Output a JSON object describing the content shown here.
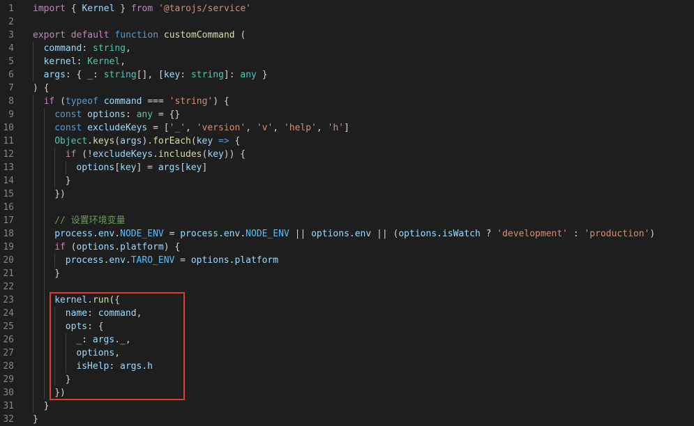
{
  "editor": {
    "highlight_color": "#e53935",
    "lines": [
      {
        "n": "1",
        "indent": 0,
        "tokens": [
          [
            "import",
            "ctl"
          ],
          [
            " { ",
            "punc"
          ],
          [
            "Kernel",
            "var"
          ],
          [
            " } ",
            "punc"
          ],
          [
            "from",
            "ctl"
          ],
          [
            " ",
            "punc"
          ],
          [
            "'@tarojs/service'",
            "str"
          ]
        ]
      },
      {
        "n": "2",
        "indent": 0,
        "tokens": []
      },
      {
        "n": "3",
        "indent": 0,
        "tokens": [
          [
            "export",
            "ctl"
          ],
          [
            " ",
            "punc"
          ],
          [
            "default",
            "ctl"
          ],
          [
            " ",
            "punc"
          ],
          [
            "function",
            "kw"
          ],
          [
            " ",
            "punc"
          ],
          [
            "customCommand",
            "fn"
          ],
          [
            " (",
            "punc"
          ]
        ]
      },
      {
        "n": "4",
        "indent": 1,
        "tokens": [
          [
            "command",
            "var"
          ],
          [
            ": ",
            "punc"
          ],
          [
            "string",
            "type"
          ],
          [
            ",",
            "punc"
          ]
        ]
      },
      {
        "n": "5",
        "indent": 1,
        "tokens": [
          [
            "kernel",
            "var"
          ],
          [
            ": ",
            "punc"
          ],
          [
            "Kernel",
            "type"
          ],
          [
            ",",
            "punc"
          ]
        ]
      },
      {
        "n": "6",
        "indent": 1,
        "tokens": [
          [
            "args",
            "var"
          ],
          [
            ": { ",
            "punc"
          ],
          [
            "_",
            "var"
          ],
          [
            ": ",
            "punc"
          ],
          [
            "string",
            "type"
          ],
          [
            "[], [",
            "punc"
          ],
          [
            "key",
            "var"
          ],
          [
            ": ",
            "punc"
          ],
          [
            "string",
            "type"
          ],
          [
            "]: ",
            "punc"
          ],
          [
            "any",
            "type"
          ],
          [
            " }",
            "punc"
          ]
        ]
      },
      {
        "n": "7",
        "indent": 0,
        "tokens": [
          [
            ") {",
            "punc"
          ]
        ]
      },
      {
        "n": "8",
        "indent": 1,
        "tokens": [
          [
            "if",
            "ctl"
          ],
          [
            " (",
            "punc"
          ],
          [
            "typeof",
            "kw"
          ],
          [
            " ",
            "punc"
          ],
          [
            "command",
            "var"
          ],
          [
            " === ",
            "punc"
          ],
          [
            "'string'",
            "str"
          ],
          [
            ") {",
            "punc"
          ]
        ]
      },
      {
        "n": "9",
        "indent": 2,
        "tokens": [
          [
            "const",
            "kw"
          ],
          [
            " ",
            "punc"
          ],
          [
            "options",
            "var"
          ],
          [
            ": ",
            "punc"
          ],
          [
            "any",
            "type"
          ],
          [
            " = {}",
            "punc"
          ]
        ]
      },
      {
        "n": "10",
        "indent": 2,
        "tokens": [
          [
            "const",
            "kw"
          ],
          [
            " ",
            "punc"
          ],
          [
            "excludeKeys",
            "var"
          ],
          [
            " = [",
            "punc"
          ],
          [
            "'_'",
            "str"
          ],
          [
            ", ",
            "punc"
          ],
          [
            "'version'",
            "str"
          ],
          [
            ", ",
            "punc"
          ],
          [
            "'v'",
            "str"
          ],
          [
            ", ",
            "punc"
          ],
          [
            "'help'",
            "str"
          ],
          [
            ", ",
            "punc"
          ],
          [
            "'h'",
            "str"
          ],
          [
            "]",
            "punc"
          ]
        ]
      },
      {
        "n": "11",
        "indent": 2,
        "tokens": [
          [
            "Object",
            "type"
          ],
          [
            ".",
            "punc"
          ],
          [
            "keys",
            "fn"
          ],
          [
            "(",
            "punc"
          ],
          [
            "args",
            "var"
          ],
          [
            ").",
            "punc"
          ],
          [
            "forEach",
            "fn"
          ],
          [
            "(",
            "punc"
          ],
          [
            "key",
            "var"
          ],
          [
            " ",
            "punc"
          ],
          [
            "=>",
            "kw"
          ],
          [
            " {",
            "punc"
          ]
        ]
      },
      {
        "n": "12",
        "indent": 3,
        "tokens": [
          [
            "if",
            "ctl"
          ],
          [
            " (!",
            "punc"
          ],
          [
            "excludeKeys",
            "var"
          ],
          [
            ".",
            "punc"
          ],
          [
            "includes",
            "fn"
          ],
          [
            "(",
            "punc"
          ],
          [
            "key",
            "var"
          ],
          [
            ")) {",
            "punc"
          ]
        ]
      },
      {
        "n": "13",
        "indent": 4,
        "tokens": [
          [
            "options",
            "var"
          ],
          [
            "[",
            "punc"
          ],
          [
            "key",
            "var"
          ],
          [
            "] = ",
            "punc"
          ],
          [
            "args",
            "var"
          ],
          [
            "[",
            "punc"
          ],
          [
            "key",
            "var"
          ],
          [
            "]",
            "punc"
          ]
        ]
      },
      {
        "n": "14",
        "indent": 3,
        "tokens": [
          [
            "}",
            "punc"
          ]
        ]
      },
      {
        "n": "15",
        "indent": 2,
        "tokens": [
          [
            "})",
            "punc"
          ]
        ]
      },
      {
        "n": "16",
        "indent": 2,
        "tokens": []
      },
      {
        "n": "17",
        "indent": 2,
        "tokens": [
          [
            "// 设置环境变量",
            "cmt"
          ]
        ]
      },
      {
        "n": "18",
        "indent": 2,
        "tokens": [
          [
            "process",
            "var"
          ],
          [
            ".",
            "punc"
          ],
          [
            "env",
            "var"
          ],
          [
            ".",
            "punc"
          ],
          [
            "NODE_ENV",
            "const"
          ],
          [
            " = ",
            "punc"
          ],
          [
            "process",
            "var"
          ],
          [
            ".",
            "punc"
          ],
          [
            "env",
            "var"
          ],
          [
            ".",
            "punc"
          ],
          [
            "NODE_ENV",
            "const"
          ],
          [
            " || ",
            "punc"
          ],
          [
            "options",
            "var"
          ],
          [
            ".",
            "punc"
          ],
          [
            "env",
            "var"
          ],
          [
            " || (",
            "punc"
          ],
          [
            "options",
            "var"
          ],
          [
            ".",
            "punc"
          ],
          [
            "isWatch",
            "var"
          ],
          [
            " ? ",
            "punc"
          ],
          [
            "'development'",
            "str"
          ],
          [
            " : ",
            "punc"
          ],
          [
            "'production'",
            "str"
          ],
          [
            ")",
            "punc"
          ]
        ]
      },
      {
        "n": "19",
        "indent": 2,
        "tokens": [
          [
            "if",
            "ctl"
          ],
          [
            " (",
            "punc"
          ],
          [
            "options",
            "var"
          ],
          [
            ".",
            "punc"
          ],
          [
            "platform",
            "var"
          ],
          [
            ") {",
            "punc"
          ]
        ]
      },
      {
        "n": "20",
        "indent": 3,
        "tokens": [
          [
            "process",
            "var"
          ],
          [
            ".",
            "punc"
          ],
          [
            "env",
            "var"
          ],
          [
            ".",
            "punc"
          ],
          [
            "TARO_ENV",
            "const"
          ],
          [
            " = ",
            "punc"
          ],
          [
            "options",
            "var"
          ],
          [
            ".",
            "punc"
          ],
          [
            "platform",
            "var"
          ]
        ]
      },
      {
        "n": "21",
        "indent": 2,
        "tokens": [
          [
            "}",
            "punc"
          ]
        ]
      },
      {
        "n": "22",
        "indent": 2,
        "tokens": []
      },
      {
        "n": "23",
        "indent": 2,
        "tokens": [
          [
            "kernel",
            "var"
          ],
          [
            ".",
            "punc"
          ],
          [
            "run",
            "fn"
          ],
          [
            "({",
            "punc"
          ]
        ]
      },
      {
        "n": "24",
        "indent": 3,
        "tokens": [
          [
            "name",
            "var"
          ],
          [
            ": ",
            "punc"
          ],
          [
            "command",
            "var"
          ],
          [
            ",",
            "punc"
          ]
        ]
      },
      {
        "n": "25",
        "indent": 3,
        "tokens": [
          [
            "opts",
            "var"
          ],
          [
            ": {",
            "punc"
          ]
        ]
      },
      {
        "n": "26",
        "indent": 4,
        "tokens": [
          [
            "_",
            "var"
          ],
          [
            ": ",
            "punc"
          ],
          [
            "args",
            "var"
          ],
          [
            ".",
            "punc"
          ],
          [
            "_",
            "var"
          ],
          [
            ",",
            "punc"
          ]
        ]
      },
      {
        "n": "27",
        "indent": 4,
        "tokens": [
          [
            "options",
            "var"
          ],
          [
            ",",
            "punc"
          ]
        ]
      },
      {
        "n": "28",
        "indent": 4,
        "tokens": [
          [
            "isHelp",
            "var"
          ],
          [
            ": ",
            "punc"
          ],
          [
            "args",
            "var"
          ],
          [
            ".",
            "punc"
          ],
          [
            "h",
            "var"
          ]
        ]
      },
      {
        "n": "29",
        "indent": 3,
        "tokens": [
          [
            "}",
            "punc"
          ]
        ]
      },
      {
        "n": "30",
        "indent": 2,
        "tokens": [
          [
            "})",
            "punc"
          ]
        ]
      },
      {
        "n": "31",
        "indent": 1,
        "tokens": [
          [
            "}",
            "punc"
          ]
        ]
      },
      {
        "n": "32",
        "indent": 0,
        "tokens": [
          [
            "}",
            "punc"
          ]
        ]
      }
    ]
  }
}
